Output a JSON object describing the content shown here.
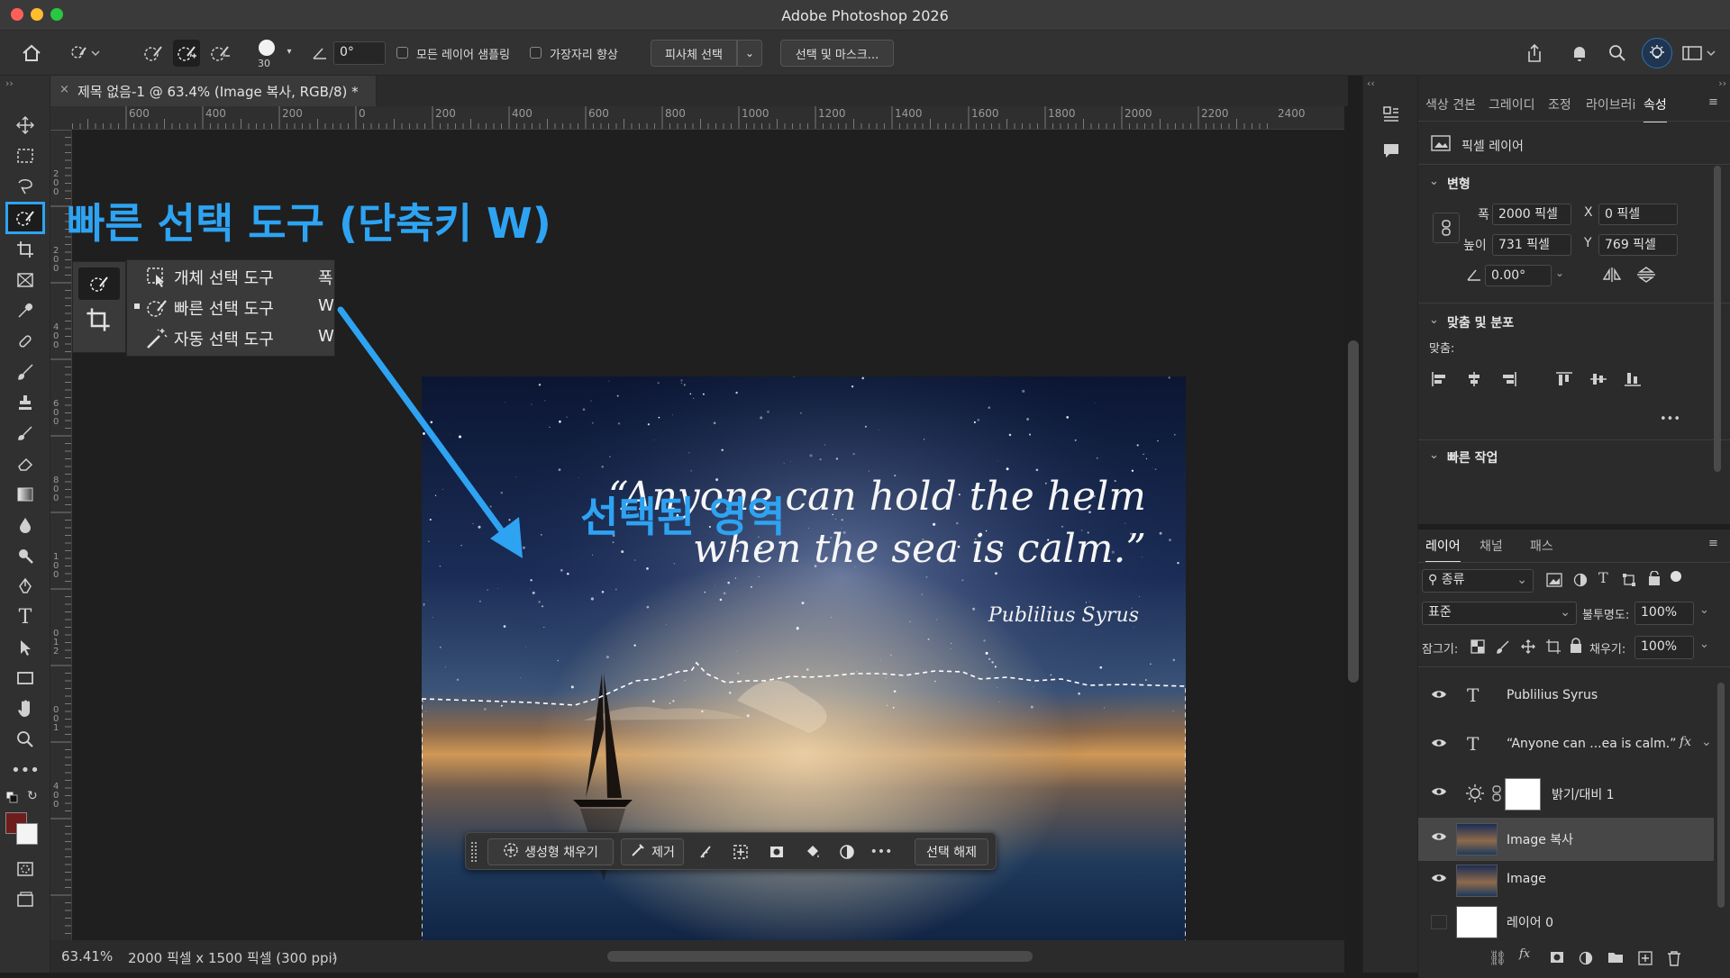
{
  "window": {
    "title": "Adobe Photoshop 2026",
    "traffic_colors": [
      "#ff5f57",
      "#febc2e",
      "#28c840"
    ]
  },
  "options_bar": {
    "brush_size": "30",
    "angle": "0°",
    "sample_all_layers": "모든 레이어 샘플링",
    "enhance_edge": "가장자리 향상",
    "select_subject": "피사체 선택",
    "select_and_mask": "선택 및 마스크..."
  },
  "document": {
    "tab_title": "제목 없음-1 @ 63.4% (Image 복사, RGB/8) *",
    "ruler_ticks": [
      "600",
      "400",
      "200",
      "0",
      "200",
      "400",
      "600",
      "800",
      "1000",
      "1200",
      "1400",
      "1600",
      "1800",
      "2000",
      "2200",
      "2400"
    ],
    "vruler_ticks": [
      "2",
      "0",
      "0",
      "2",
      "0",
      "0",
      "4",
      "0",
      "0",
      "6",
      "0",
      "0",
      "8",
      "0",
      "0",
      "1",
      "0",
      "0",
      "0",
      "1",
      "2",
      "0",
      "0",
      "1",
      "4",
      "0",
      "0"
    ]
  },
  "annotation": {
    "heading": "빠른 선택 도구 (단축키 W)",
    "selected_area": "선택된 영역",
    "accent_color": "#2ea3f2"
  },
  "flyout": {
    "items": [
      {
        "label": "개체 선택 도구",
        "shortcut": "폭",
        "icon": "object-select-icon"
      },
      {
        "label": "빠른 선택 도구",
        "shortcut": "W",
        "icon": "quick-select-icon"
      },
      {
        "label": "자동 선택 도구",
        "shortcut": "W",
        "icon": "magic-wand-icon"
      }
    ]
  },
  "artwork": {
    "quote_line1": "“Anyone can hold the helm",
    "quote_line2": "when the sea is calm.”",
    "author": "Publilius Syrus"
  },
  "taskbar": {
    "generative_fill": "생성형 채우기",
    "remove": "제거",
    "deselect": "선택 해제"
  },
  "status": {
    "zoom": "63.41%",
    "doc_info": "2000 픽셀 x 1500 픽셀 (300 ppi)"
  },
  "properties": {
    "tabs": [
      "색상 견본",
      "그레이디",
      "조정",
      "라이브러i",
      "속성"
    ],
    "active_tab": "속성",
    "layer_type": "픽셀 레이어",
    "transform_label": "변형",
    "width_label": "폭",
    "width": "2000 픽셀",
    "height_label": "높이",
    "height": "731 픽셀",
    "x_label": "X",
    "x": "0 픽셀",
    "y_label": "Y",
    "y": "769 픽셀",
    "angle": "0.00°",
    "align_label": "맞춤 및 분포",
    "align_sub": "맞춤:",
    "quick_actions": "빠른 작업"
  },
  "layers_panel": {
    "tabs": [
      "레이어",
      "채널",
      "패스"
    ],
    "filter": "종류",
    "blend_mode": "표준",
    "opacity_label": "불투명도:",
    "opacity": "100%",
    "lock_label": "잠그기:",
    "fill_label": "채우기:",
    "fill": "100%",
    "layers": [
      {
        "name": "Publilius Syrus",
        "kind": "text"
      },
      {
        "name": "“Anyone can ...ea is calm.”",
        "kind": "text",
        "fx": "fx"
      },
      {
        "name": "밝기/대비 1",
        "kind": "adjustment"
      },
      {
        "name": "Image 복사",
        "kind": "image",
        "selected": true
      },
      {
        "name": "Image",
        "kind": "image"
      },
      {
        "name": "레이어 0",
        "kind": "white"
      }
    ]
  }
}
